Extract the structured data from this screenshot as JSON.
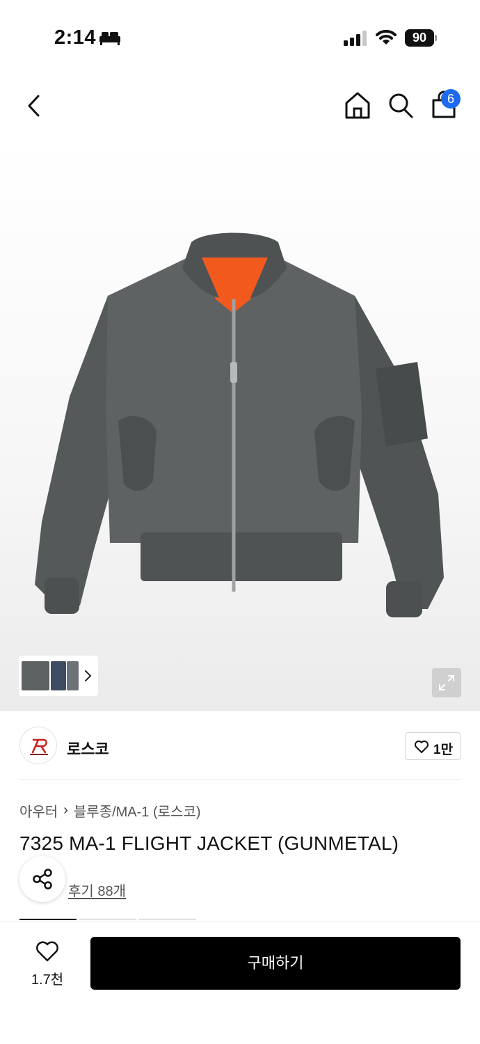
{
  "status_bar": {
    "time": "2:14",
    "battery": "90"
  },
  "nav": {
    "cart_count": "6"
  },
  "brand": {
    "name": "로스코",
    "logo_text": "ROTHCO",
    "like_count": "1만"
  },
  "breadcrumb": {
    "category": "아우터",
    "subcategory": "블루종/MA-1 (로스코)"
  },
  "product": {
    "title": "7325 MA-1 FLIGHT JACKET (GUNMETAL)",
    "review_link": "후기 88개"
  },
  "bottom_bar": {
    "wish_count": "1.7천",
    "buy_label": "구매하기"
  },
  "colors": {
    "accent_badge": "#1e6bef",
    "buy_button": "#000000",
    "jacket": "#5e6263",
    "lining": "#f25a1d"
  },
  "icons": [
    "bed-icon",
    "signal-icon",
    "wifi-icon",
    "back-icon",
    "home-icon",
    "search-icon",
    "shopping-bag-icon",
    "expand-icon",
    "heart-icon",
    "share-icon"
  ]
}
